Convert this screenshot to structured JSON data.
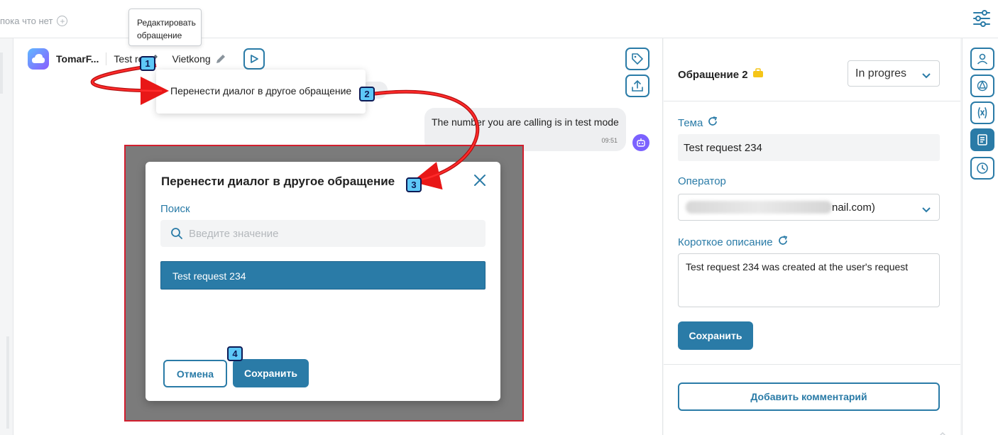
{
  "topbar": {
    "no_tags_text": "пока что нет"
  },
  "tooltip": {
    "text": "Редактировать обращение"
  },
  "chat": {
    "app_name": "TomarF...",
    "request_name": "Test re",
    "operator_name": "Vietkong",
    "message": {
      "text": "The number you are calling is in test mode",
      "time": "09:51"
    }
  },
  "context_menu": {
    "item": "Перенести диалог в другое обращение"
  },
  "modal": {
    "title": "Перенести диалог в другое обращение",
    "search_label": "Поиск",
    "search_placeholder": "Введите значение",
    "results": [
      "Test request 234"
    ],
    "cancel_label": "Отмена",
    "save_label": "Сохранить"
  },
  "right_panel": {
    "ticket_title": "Обращение 2",
    "status": "In progres",
    "topic_label": "Тема",
    "topic_value": "Test request 234",
    "operator_label": "Оператор",
    "operator_value": "nail.com)",
    "short_desc_label": "Короткое описание",
    "short_desc_value": "Test request 234 was created at the user's request",
    "save_label": "Сохранить",
    "add_comment_label": "Добавить комментарий"
  },
  "annotations": {
    "badges": [
      "1",
      "2",
      "3",
      "4"
    ],
    "arrow_color": "#e81717",
    "highlight_border_color": "#d21f2f"
  },
  "colors": {
    "accent": "#2a7ba7",
    "overlay": "#7b7b7b"
  },
  "icons": {
    "filter": "sliders-icon",
    "tag": "tag-icon",
    "upload": "upload-icon",
    "play": "play-icon",
    "bot": "bot-icon",
    "search": "search-icon",
    "close": "close-icon",
    "refresh": "refresh-icon",
    "chevron": "chevron-down-icon",
    "user": "user-icon",
    "openai": "openai-icon",
    "variable": "variable-icon",
    "notes": "notes-icon",
    "history": "clock-icon"
  }
}
